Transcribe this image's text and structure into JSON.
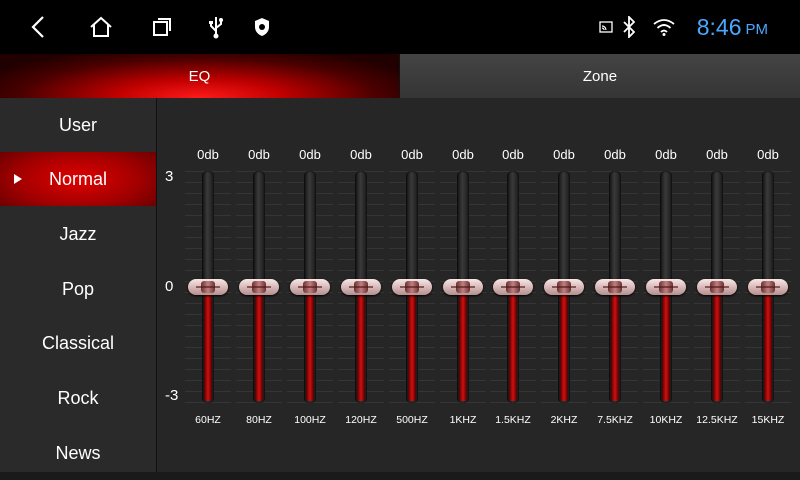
{
  "status_bar": {
    "icons": [
      "back-icon",
      "home-icon",
      "recents-icon",
      "usb-icon",
      "shield-icon",
      "cast-icon",
      "bluetooth-icon",
      "wifi-icon"
    ],
    "time": "8:46",
    "ampm": "PM",
    "time_color": "#4aa7ff"
  },
  "tabs": [
    {
      "label": "EQ",
      "active": true
    },
    {
      "label": "Zone",
      "active": false
    }
  ],
  "presets": [
    {
      "label": "User",
      "active": false
    },
    {
      "label": "Normal",
      "active": true
    },
    {
      "label": "Jazz",
      "active": false
    },
    {
      "label": "Pop",
      "active": false
    },
    {
      "label": "Classical",
      "active": false
    },
    {
      "label": "Rock",
      "active": false
    },
    {
      "label": "News",
      "active": false
    }
  ],
  "eq": {
    "scale": {
      "top": "3",
      "mid": "0",
      "bottom": "-3"
    },
    "range": [
      -3,
      3
    ],
    "bands": [
      {
        "freq": "60HZ",
        "gain_label": "0db",
        "gain": 0
      },
      {
        "freq": "80HZ",
        "gain_label": "0db",
        "gain": 0
      },
      {
        "freq": "100HZ",
        "gain_label": "0db",
        "gain": 0
      },
      {
        "freq": "120HZ",
        "gain_label": "0db",
        "gain": 0
      },
      {
        "freq": "500HZ",
        "gain_label": "0db",
        "gain": 0
      },
      {
        "freq": "1KHZ",
        "gain_label": "0db",
        "gain": 0
      },
      {
        "freq": "1.5KHZ",
        "gain_label": "0db",
        "gain": 0
      },
      {
        "freq": "2KHZ",
        "gain_label": "0db",
        "gain": 0
      },
      {
        "freq": "7.5KHZ",
        "gain_label": "0db",
        "gain": 0
      },
      {
        "freq": "10KHZ",
        "gain_label": "0db",
        "gain": 0
      },
      {
        "freq": "12.5KHZ",
        "gain_label": "0db",
        "gain": 0
      },
      {
        "freq": "15KHZ",
        "gain_label": "0db",
        "gain": 0
      }
    ]
  },
  "colors": {
    "accent": "#d01010",
    "background": "#262626"
  }
}
